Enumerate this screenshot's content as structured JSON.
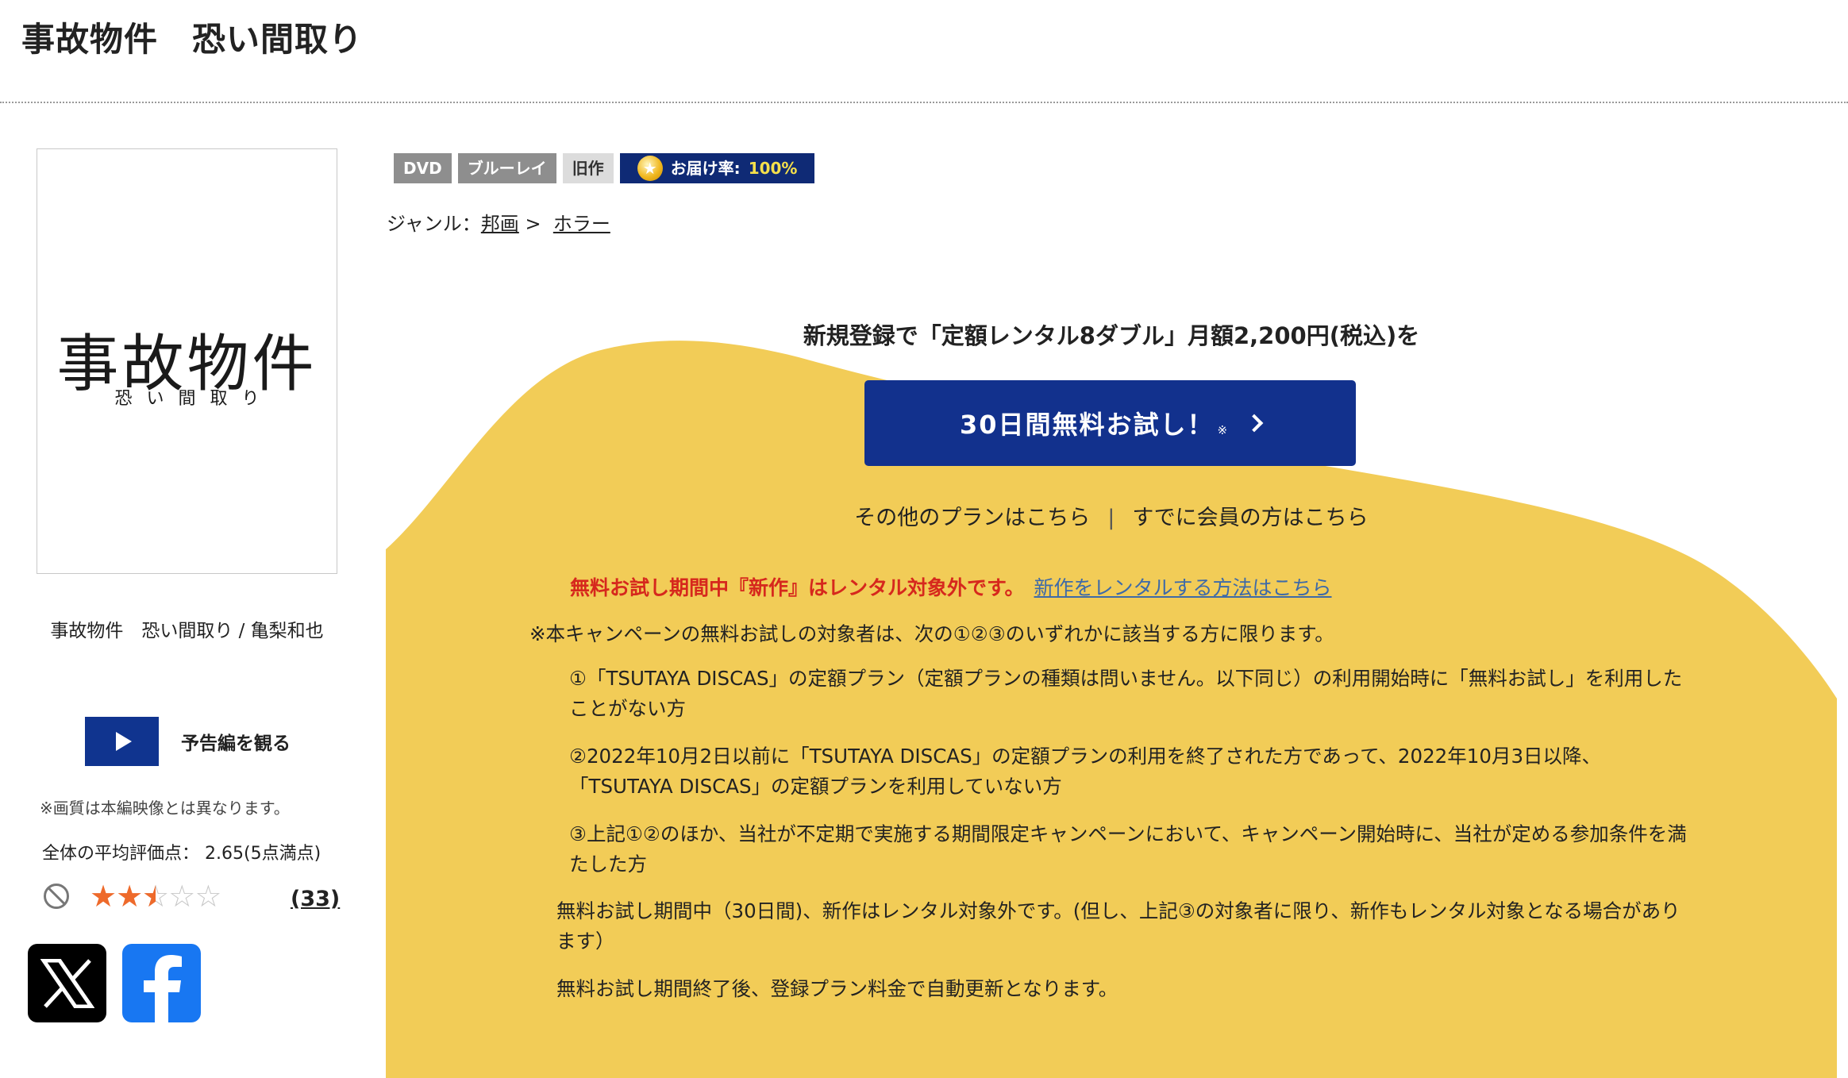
{
  "page": {
    "title": "事故物件　恐い間取り"
  },
  "jacket": {
    "main_text": "事故物件",
    "sub_text": "恐い間取り",
    "caption": "事故物件　恐い間取り / 亀梨和也"
  },
  "trailer": {
    "label": "予告編を観る",
    "icon": "play-icon"
  },
  "image_note": "※画質は本編映像とは異なります。",
  "rating": {
    "label": "全体の平均評価点：",
    "score": "2.65(5点満点)",
    "value": 2.65,
    "max": 5,
    "review_count": "(33)"
  },
  "social": {
    "x_icon": "x-icon",
    "facebook_icon": "facebook-icon"
  },
  "badges": {
    "dvd": "DVD",
    "bluray": "ブルーレイ",
    "old": "旧作",
    "delivery_label": "お届け率:",
    "delivery_value": "100%"
  },
  "genre": {
    "label": "ジャンル：",
    "crumbs": [
      "邦画",
      "ホラー"
    ],
    "separator": ">"
  },
  "promo": {
    "headline": "新規登録で「定額レンタル8ダブル」月額2,200円(税込)を",
    "button_label": "30日間無料お試し！",
    "button_note": "※",
    "link_other_plans": "その他のプランはこちら",
    "link_separator": "|",
    "link_members": "すでに会員の方はこちら",
    "warning": "無料お試し期間中『新作』はレンタル対象外です。",
    "warning_link": "新作をレンタルする方法はこちら",
    "conditions_intro": "※本キャンペーンの無料お試しの対象者は、次の①②③のいずれかに該当する方に限ります。",
    "conditions": [
      "①「TSUTAYA DISCAS」の定額プラン（定額プランの種類は問いません。以下同じ）の利用開始時に「無料お試し」を利用したことがない方",
      "②2022年10月2日以前に「TSUTAYA DISCAS」の定額プランの利用を終了された方であって、2022年10月3日以降、「TSUTAYA DISCAS」の定額プランを利用していない方",
      "③上記①②のほか、当社が不定期で実施する期間限定キャンペーンにおいて、キャンペーン開始時に、当社が定める参加条件を満たした方"
    ],
    "note_1": "無料お試し期間中（30日間)、新作はレンタル対象外です。(但し、上記③の対象者に限り、新作もレンタル対象となる場合があります）",
    "note_2": "無料お試し期間終了後、登録プラン料金で自動更新となります。"
  },
  "colors": {
    "navy": "#12318d",
    "promo_yellow": "#f2cc57",
    "warning_red": "#d6281d",
    "link_blue": "#3e6aa8",
    "star_orange": "#ee6a2b"
  }
}
